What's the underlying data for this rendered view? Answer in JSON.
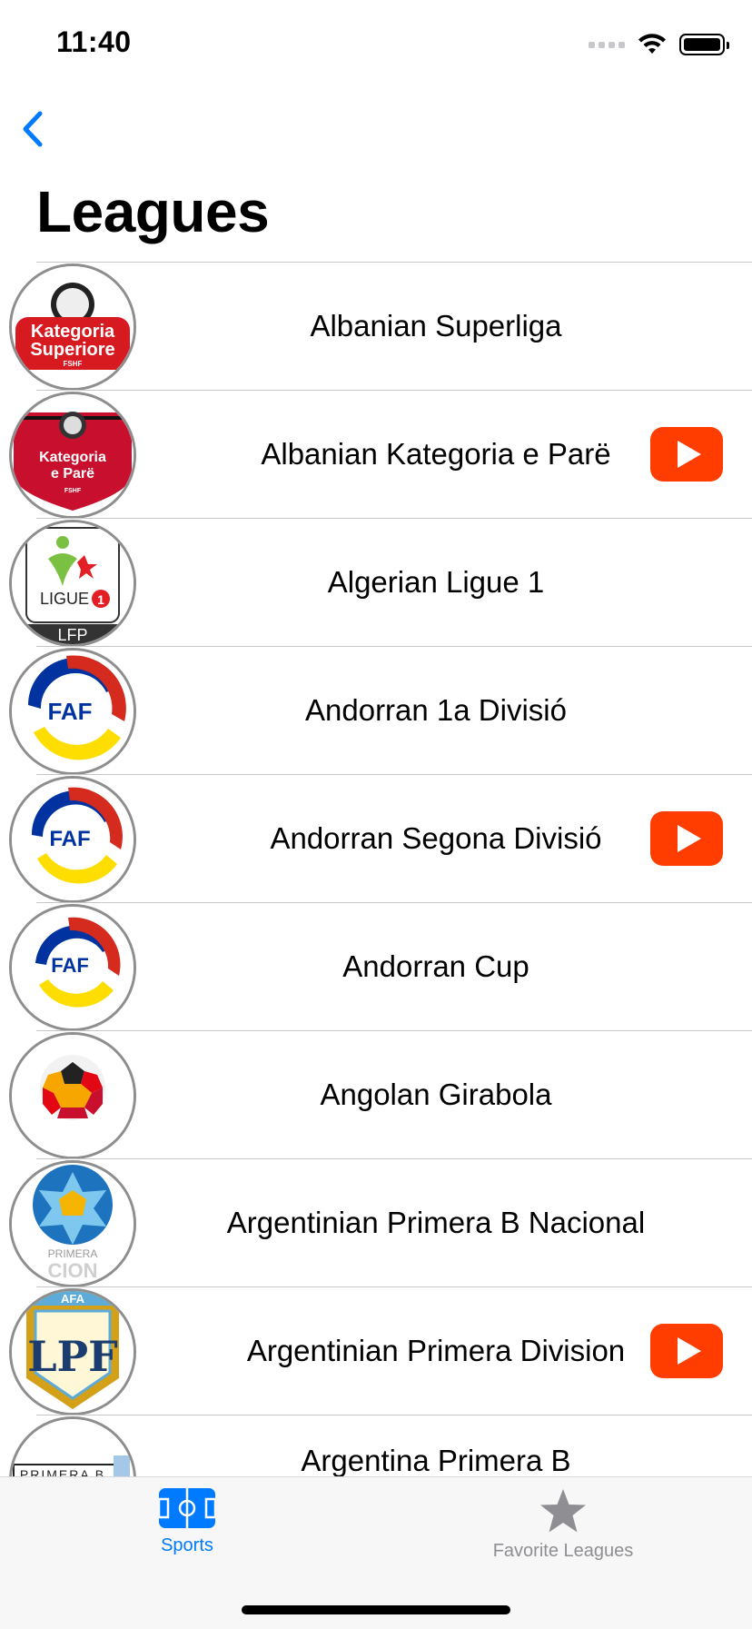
{
  "status_bar": {
    "time": "11:40"
  },
  "nav": {
    "title": "Leagues"
  },
  "leagues": [
    {
      "name": "Albanian Superliga",
      "logo_text": [
        "Kategoria",
        "Superiore",
        "FSHF"
      ],
      "has_video": false
    },
    {
      "name": "Albanian Kategoria e Parë",
      "logo_text": [
        "Kategoria",
        "e Parë",
        "FSHF"
      ],
      "has_video": true
    },
    {
      "name": "Algerian Ligue 1",
      "logo_text": [
        "LIGUE",
        "1",
        "LFP"
      ],
      "has_video": false
    },
    {
      "name": "Andorran 1a Divisió",
      "logo_text": [
        "FAF"
      ],
      "has_video": false
    },
    {
      "name": "Andorran Segona Divisió",
      "logo_text": [
        "FAF"
      ],
      "has_video": true
    },
    {
      "name": "Andorran Cup",
      "logo_text": [
        "FAF"
      ],
      "has_video": false
    },
    {
      "name": "Angolan Girabola",
      "logo_text": [],
      "has_video": false
    },
    {
      "name": "Argentinian Primera B Nacional",
      "logo_text": [
        "PRIMERA",
        "CION"
      ],
      "has_video": false
    },
    {
      "name": "Argentinian Primera Division",
      "logo_text": [
        "AFA",
        "LPF"
      ],
      "has_video": true
    },
    {
      "name": "Argentina Primera B",
      "logo_text": [
        "PRIMERA B"
      ],
      "has_video": false
    }
  ],
  "tabs": [
    {
      "label": "Sports",
      "icon": "soccer-field-icon",
      "active": true
    },
    {
      "label": "Favorite Leagues",
      "icon": "star-icon",
      "active": false
    }
  ],
  "colors": {
    "accent": "#007aff",
    "inactive": "#8e8e93",
    "youtube": "#ff3d00"
  }
}
